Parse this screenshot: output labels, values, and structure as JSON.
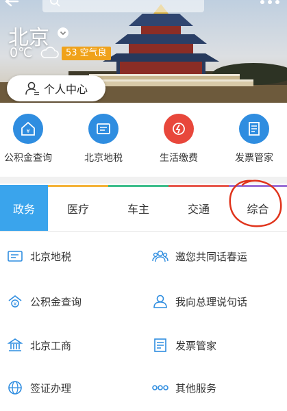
{
  "header": {
    "city": "北京",
    "temperature": "0℃",
    "aqi": "53 空气良",
    "profile_label": "个人中心"
  },
  "quick_services": [
    {
      "label": "公积金查询",
      "icon": "housing-fund-icon",
      "color": "#2f8de0"
    },
    {
      "label": "北京地税",
      "icon": "tax-card-icon",
      "color": "#2f8de0"
    },
    {
      "label": "生活缴费",
      "icon": "bill-pay-icon",
      "color": "#e8473b"
    },
    {
      "label": "发票管家",
      "icon": "invoice-icon",
      "color": "#2f8de0"
    }
  ],
  "tabs": [
    {
      "label": "政务",
      "active": true,
      "color": "#3aa4ec"
    },
    {
      "label": "医疗",
      "active": false,
      "color": "#f4b33a"
    },
    {
      "label": "车主",
      "active": false,
      "color": "#3fbe8c"
    },
    {
      "label": "交通",
      "active": false,
      "color": "#e85a4f"
    },
    {
      "label": "综合",
      "active": false,
      "color": "#9b72d6"
    }
  ],
  "services": [
    {
      "label": "北京地税",
      "icon": "tax-card-icon"
    },
    {
      "label": "邀您共同话春运",
      "icon": "group-icon"
    },
    {
      "label": "公积金查询",
      "icon": "housing-fund-icon"
    },
    {
      "label": "我向总理说句话",
      "icon": "user-speak-icon"
    },
    {
      "label": "北京工商",
      "icon": "bank-building-icon"
    },
    {
      "label": "发票管家",
      "icon": "invoice-icon"
    },
    {
      "label": "签证办理",
      "icon": "globe-icon"
    },
    {
      "label": "其他服务",
      "icon": "more-dots-icon"
    }
  ],
  "colors": {
    "accent": "#3aa4ec",
    "icon_blue": "#2f8de0",
    "annotation_red": "#e0341c",
    "aqi_badge": "#f0a21a"
  }
}
